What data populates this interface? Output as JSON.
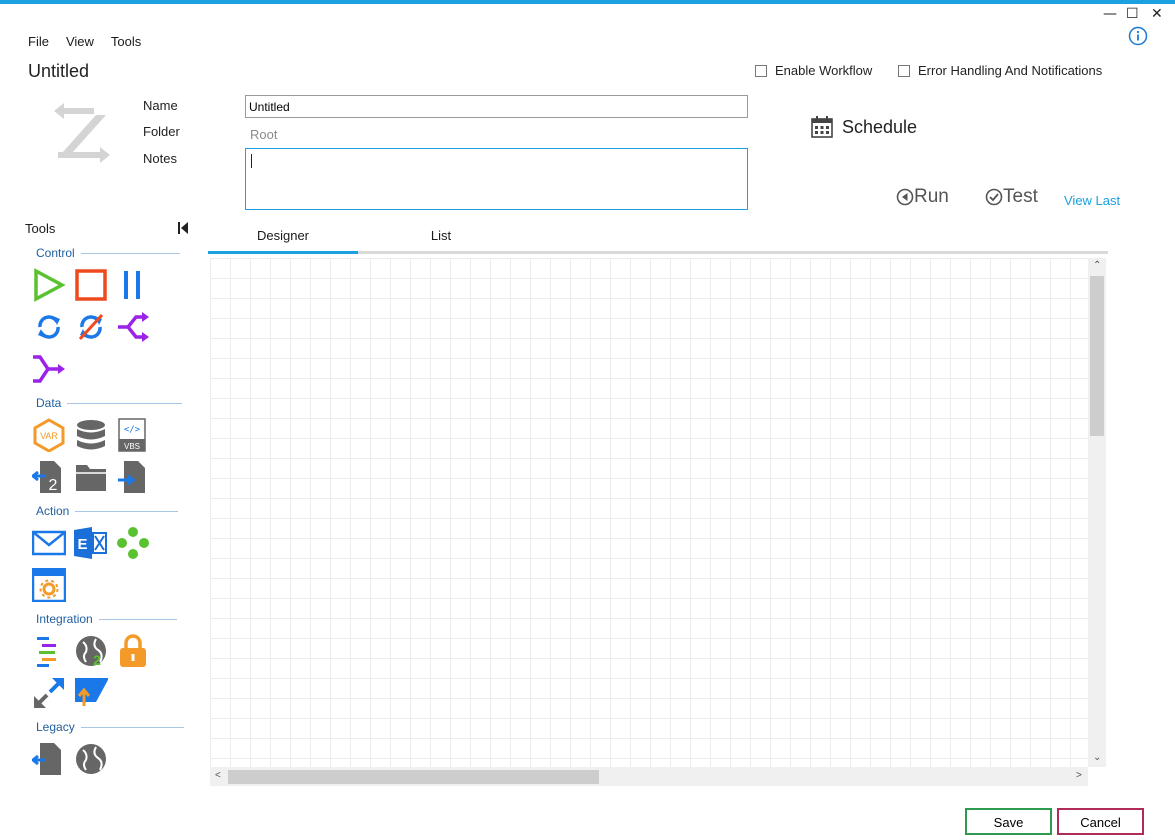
{
  "window": {
    "minimize_glyph": "—",
    "maximize_glyph": "☐",
    "close_glyph": "✕",
    "info_icon": "info-icon"
  },
  "menu": {
    "items": [
      "File",
      "View",
      "Tools"
    ]
  },
  "document": {
    "title": "Untitled"
  },
  "options": {
    "enable_workflow": "Enable Workflow",
    "error_handling": "Error Handling And Notifications"
  },
  "form": {
    "name_label": "Name",
    "folder_label": "Folder",
    "notes_label": "Notes",
    "name_value": "Untitled",
    "folder_value": "Root",
    "notes_value": ""
  },
  "actions": {
    "schedule": "Schedule",
    "run": "Run",
    "test": "Test",
    "view_last": "View Last"
  },
  "tools_panel": {
    "heading": "Tools",
    "sections": {
      "control": "Control",
      "data": "Data",
      "action": "Action",
      "integration": "Integration",
      "legacy": "Legacy"
    }
  },
  "tabs": {
    "designer": "Designer",
    "list": "List"
  },
  "footer": {
    "save": "Save",
    "cancel": "Cancel"
  },
  "colors": {
    "accent": "#1ba1e2",
    "save_border": "#2e9a4e",
    "cancel_border": "#b02a5a"
  }
}
